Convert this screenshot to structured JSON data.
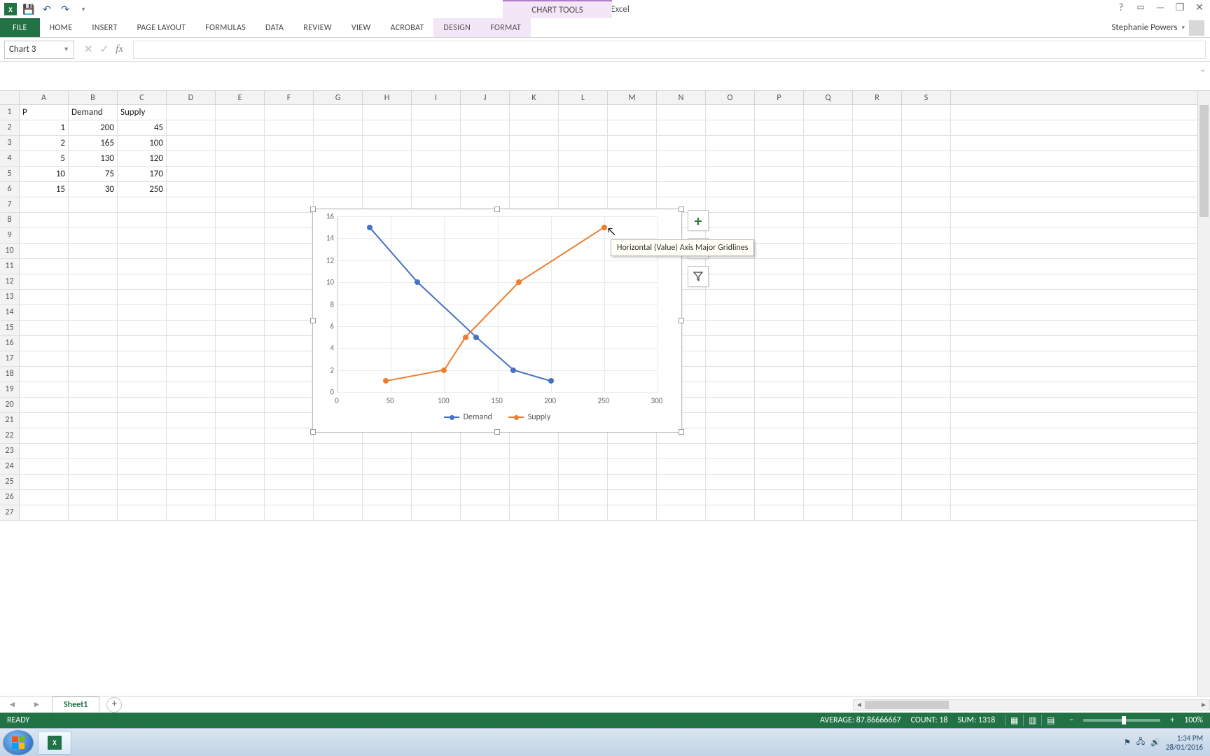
{
  "app": {
    "title": "Book1 - Excel",
    "chart_tools_label": "CHART TOOLS"
  },
  "qat": {
    "icons": [
      "save-icon",
      "undo-icon",
      "redo-icon",
      "customize-icon"
    ]
  },
  "window_controls": {
    "help": "?",
    "fullscreen": "⤢",
    "minimize": "—",
    "restore": "❐",
    "close": "✕"
  },
  "ribbon": {
    "file": "FILE",
    "tabs": [
      "HOME",
      "INSERT",
      "PAGE LAYOUT",
      "FORMULAS",
      "DATA",
      "REVIEW",
      "VIEW",
      "ACROBAT"
    ],
    "contextual": [
      "DESIGN",
      "FORMAT"
    ],
    "user": "Stephanie Powers"
  },
  "namebox": "Chart 3",
  "columns": [
    "A",
    "B",
    "C",
    "D",
    "E",
    "F",
    "G",
    "H",
    "I",
    "J",
    "K",
    "L",
    "M",
    "N",
    "O",
    "P",
    "Q",
    "R",
    "S"
  ],
  "grid": {
    "headers": {
      "A1": "P",
      "B1": "Demand",
      "C1": "Supply"
    },
    "rows": [
      {
        "A": "1",
        "B": "200",
        "C": "45"
      },
      {
        "A": "2",
        "B": "165",
        "C": "100"
      },
      {
        "A": "5",
        "B": "130",
        "C": "120"
      },
      {
        "A": "10",
        "B": "75",
        "C": "170"
      },
      {
        "A": "15",
        "B": "30",
        "C": "250"
      }
    ]
  },
  "chart": {
    "tooltip": "Horizontal (Value) Axis Major Gridlines",
    "sidebtns": [
      "plus",
      "brush",
      "filter"
    ]
  },
  "sheets": {
    "active": "Sheet1"
  },
  "status": {
    "ready": "READY",
    "average": "AVERAGE: 87.86666667",
    "count": "COUNT: 18",
    "sum": "SUM: 1318",
    "zoom": "100%"
  },
  "taskbar": {
    "time": "1:34 PM",
    "date": "28/01/2016"
  },
  "chart_data": {
    "type": "line",
    "title": "",
    "xlabel": "",
    "ylabel": "",
    "xlim": [
      0,
      300
    ],
    "ylim": [
      0,
      16
    ],
    "xticks": [
      0,
      50,
      100,
      150,
      200,
      250,
      300
    ],
    "yticks": [
      0,
      2,
      4,
      6,
      8,
      10,
      12,
      14,
      16
    ],
    "series": [
      {
        "name": "Demand",
        "color": "#4472c4",
        "points": [
          {
            "x": 30,
            "y": 15
          },
          {
            "x": 75,
            "y": 10
          },
          {
            "x": 130,
            "y": 5
          },
          {
            "x": 165,
            "y": 2
          },
          {
            "x": 200,
            "y": 1
          }
        ]
      },
      {
        "name": "Supply",
        "color": "#ed7d31",
        "points": [
          {
            "x": 45,
            "y": 1
          },
          {
            "x": 100,
            "y": 2
          },
          {
            "x": 120,
            "y": 5
          },
          {
            "x": 170,
            "y": 10
          },
          {
            "x": 250,
            "y": 15
          }
        ]
      }
    ],
    "legend": [
      "Demand",
      "Supply"
    ]
  }
}
